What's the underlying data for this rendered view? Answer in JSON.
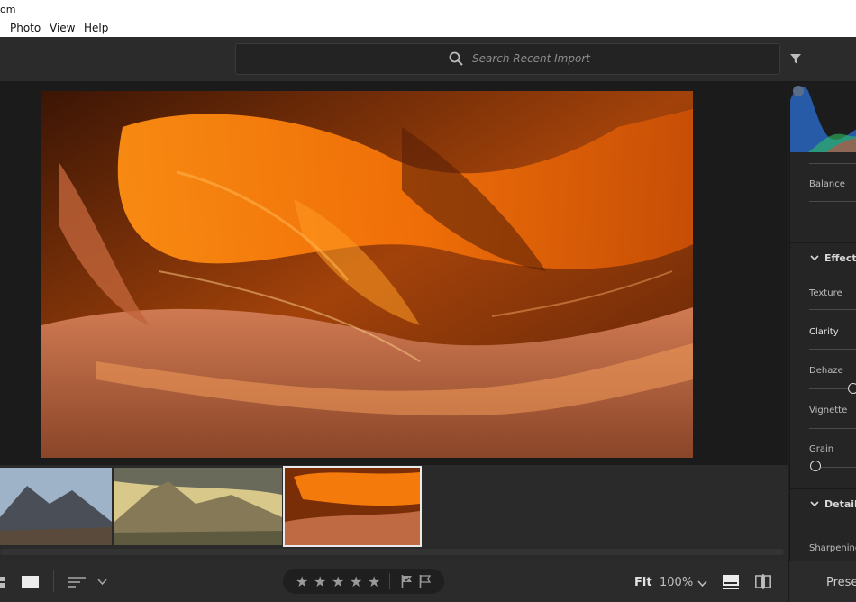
{
  "window": {
    "title_fragment": "om"
  },
  "menu": {
    "items": [
      "Photo",
      "View",
      "Help"
    ]
  },
  "toolbar": {
    "search_placeholder": "Search Recent Import"
  },
  "panel": {
    "labels": {
      "balance": "Balance",
      "effects": "Effects",
      "texture": "Texture",
      "clarity": "Clarity",
      "dehaze": "Dehaze",
      "vignette": "Vignette",
      "grain": "Grain",
      "detail": "Detail",
      "sharpening": "Sharpening"
    }
  },
  "filmstrip": {
    "thumbnails": [
      {
        "name": "mountain-valley",
        "selected": false
      },
      {
        "name": "golden-peaks",
        "selected": false
      },
      {
        "name": "antelope-canyon",
        "selected": true
      }
    ]
  },
  "bottombar": {
    "stars": [
      "★",
      "★",
      "★",
      "★",
      "★"
    ],
    "fit_label": "Fit",
    "zoom_label": "100%",
    "presets_label": "Prese"
  },
  "colors": {
    "accent": "#e9e9e9",
    "panel": "#252525",
    "toolbar": "#2b2b2b"
  }
}
